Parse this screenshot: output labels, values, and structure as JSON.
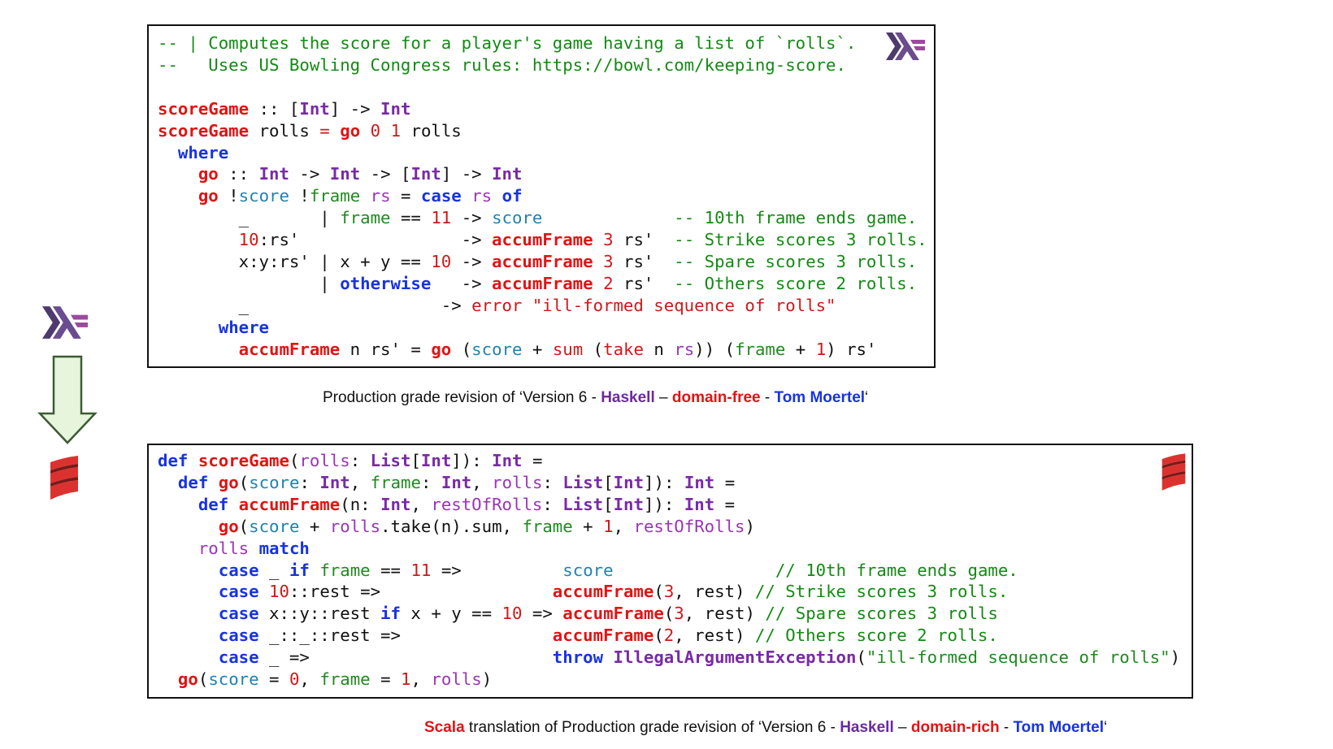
{
  "haskell_code": {
    "lines": [
      [
        {
          "t": "-- | Computes the score for a player's game having a list of `rolls`.",
          "c": "cm"
        }
      ],
      [
        {
          "t": "--   Uses US Bowling Congress rules: https://bowl.com/keeping-score.",
          "c": "cm"
        }
      ],
      [
        {
          "t": ""
        }
      ],
      [
        {
          "t": "scoreGame",
          "c": "fn"
        },
        {
          "t": " :: ["
        },
        {
          "t": "Int",
          "c": "ty"
        },
        {
          "t": "] -> "
        },
        {
          "t": "Int",
          "c": "ty"
        }
      ],
      [
        {
          "t": "scoreGame",
          "c": "fn"
        },
        {
          "t": " rolls "
        },
        {
          "t": "=",
          "c": "num"
        },
        {
          "t": " "
        },
        {
          "t": "go",
          "c": "fn"
        },
        {
          "t": " "
        },
        {
          "t": "0",
          "c": "num"
        },
        {
          "t": " "
        },
        {
          "t": "1",
          "c": "num"
        },
        {
          "t": " rolls"
        }
      ],
      [
        {
          "t": "  "
        },
        {
          "t": "where",
          "c": "kw"
        }
      ],
      [
        {
          "t": "    "
        },
        {
          "t": "go",
          "c": "fn"
        },
        {
          "t": " :: "
        },
        {
          "t": "Int",
          "c": "ty"
        },
        {
          "t": " -> "
        },
        {
          "t": "Int",
          "c": "ty"
        },
        {
          "t": " -> ["
        },
        {
          "t": "Int",
          "c": "ty"
        },
        {
          "t": "] -> "
        },
        {
          "t": "Int",
          "c": "ty"
        }
      ],
      [
        {
          "t": "    "
        },
        {
          "t": "go",
          "c": "fn"
        },
        {
          "t": " !"
        },
        {
          "t": "score",
          "c": "vb"
        },
        {
          "t": " !"
        },
        {
          "t": "frame",
          "c": "vg"
        },
        {
          "t": " "
        },
        {
          "t": "rs",
          "c": "vp"
        },
        {
          "t": " = "
        },
        {
          "t": "case",
          "c": "kw"
        },
        {
          "t": " "
        },
        {
          "t": "rs",
          "c": "vp"
        },
        {
          "t": " "
        },
        {
          "t": "of",
          "c": "kw"
        }
      ],
      [
        {
          "t": "        _       | "
        },
        {
          "t": "frame",
          "c": "vg"
        },
        {
          "t": " == "
        },
        {
          "t": "11",
          "c": "num"
        },
        {
          "t": " -> "
        },
        {
          "t": "score",
          "c": "vb"
        },
        {
          "t": "             "
        },
        {
          "t": "-- 10th frame ends game.",
          "c": "cm"
        }
      ],
      [
        {
          "t": "        "
        },
        {
          "t": "10",
          "c": "num"
        },
        {
          "t": ":rs'                -> "
        },
        {
          "t": "accumFrame",
          "c": "fn"
        },
        {
          "t": " "
        },
        {
          "t": "3",
          "c": "num"
        },
        {
          "t": " rs'  "
        },
        {
          "t": "-- Strike scores 3 rolls.",
          "c": "cm"
        }
      ],
      [
        {
          "t": "        x:y:rs' | x + y == "
        },
        {
          "t": "10",
          "c": "num"
        },
        {
          "t": " -> "
        },
        {
          "t": "accumFrame",
          "c": "fn"
        },
        {
          "t": " "
        },
        {
          "t": "3",
          "c": "num"
        },
        {
          "t": " rs'  "
        },
        {
          "t": "-- Spare scores 3 rolls.",
          "c": "cm"
        }
      ],
      [
        {
          "t": "                | "
        },
        {
          "t": "otherwise",
          "c": "kw"
        },
        {
          "t": "   -> "
        },
        {
          "t": "accumFrame",
          "c": "fn"
        },
        {
          "t": " "
        },
        {
          "t": "2",
          "c": "num"
        },
        {
          "t": " rs'  "
        },
        {
          "t": "-- Others score 2 rolls.",
          "c": "cm"
        }
      ],
      [
        {
          "t": "        _                   -> "
        },
        {
          "t": "error \"ill-formed sequence of rolls\"",
          "c": "str"
        }
      ],
      [
        {
          "t": "      "
        },
        {
          "t": "where",
          "c": "kw"
        }
      ],
      [
        {
          "t": "        "
        },
        {
          "t": "accumFrame",
          "c": "fn"
        },
        {
          "t": " n rs' = "
        },
        {
          "t": "go",
          "c": "fn"
        },
        {
          "t": " ("
        },
        {
          "t": "score",
          "c": "vb"
        },
        {
          "t": " + "
        },
        {
          "t": "sum",
          "c": "str"
        },
        {
          "t": " ("
        },
        {
          "t": "take",
          "c": "str"
        },
        {
          "t": " n "
        },
        {
          "t": "rs",
          "c": "vp"
        },
        {
          "t": ")) ("
        },
        {
          "t": "frame",
          "c": "vg"
        },
        {
          "t": " + "
        },
        {
          "t": "1",
          "c": "num"
        },
        {
          "t": ") rs'"
        }
      ]
    ]
  },
  "haskell_caption": [
    {
      "t": "Production grade revision of ‘Version 6 - "
    },
    {
      "t": "Haskell",
      "c": "c-purple"
    },
    {
      "t": " – "
    },
    {
      "t": "domain-free",
      "c": "c-red"
    },
    {
      "t": " - "
    },
    {
      "t": "Tom Moertel",
      "c": "c-blue"
    },
    {
      "t": "‘"
    }
  ],
  "scala_code": {
    "lines": [
      [
        {
          "t": "def",
          "c": "kw"
        },
        {
          "t": " "
        },
        {
          "t": "scoreGame",
          "c": "fn"
        },
        {
          "t": "("
        },
        {
          "t": "rolls",
          "c": "vp"
        },
        {
          "t": ": "
        },
        {
          "t": "List",
          "c": "ty"
        },
        {
          "t": "["
        },
        {
          "t": "Int",
          "c": "ty"
        },
        {
          "t": "]): "
        },
        {
          "t": "Int",
          "c": "ty"
        },
        {
          "t": " ="
        }
      ],
      [
        {
          "t": "  "
        },
        {
          "t": "def",
          "c": "kw"
        },
        {
          "t": " "
        },
        {
          "t": "go",
          "c": "fn"
        },
        {
          "t": "("
        },
        {
          "t": "score",
          "c": "vb"
        },
        {
          "t": ": "
        },
        {
          "t": "Int",
          "c": "ty"
        },
        {
          "t": ", "
        },
        {
          "t": "frame",
          "c": "vg"
        },
        {
          "t": ": "
        },
        {
          "t": "Int",
          "c": "ty"
        },
        {
          "t": ", "
        },
        {
          "t": "rolls",
          "c": "vp"
        },
        {
          "t": ": "
        },
        {
          "t": "List",
          "c": "ty"
        },
        {
          "t": "["
        },
        {
          "t": "Int",
          "c": "ty"
        },
        {
          "t": "]): "
        },
        {
          "t": "Int",
          "c": "ty"
        },
        {
          "t": " ="
        }
      ],
      [
        {
          "t": "    "
        },
        {
          "t": "def",
          "c": "kw"
        },
        {
          "t": " "
        },
        {
          "t": "accumFrame",
          "c": "fn"
        },
        {
          "t": "(n: "
        },
        {
          "t": "Int",
          "c": "ty"
        },
        {
          "t": ", "
        },
        {
          "t": "restOfRolls",
          "c": "vp"
        },
        {
          "t": ": "
        },
        {
          "t": "List",
          "c": "ty"
        },
        {
          "t": "["
        },
        {
          "t": "Int",
          "c": "ty"
        },
        {
          "t": "]): "
        },
        {
          "t": "Int",
          "c": "ty"
        },
        {
          "t": " ="
        }
      ],
      [
        {
          "t": "      "
        },
        {
          "t": "go",
          "c": "fn"
        },
        {
          "t": "("
        },
        {
          "t": "score",
          "c": "vb"
        },
        {
          "t": " + "
        },
        {
          "t": "rolls",
          "c": "vp"
        },
        {
          "t": ".take(n).sum, "
        },
        {
          "t": "frame",
          "c": "vg"
        },
        {
          "t": " + "
        },
        {
          "t": "1",
          "c": "num"
        },
        {
          "t": ", "
        },
        {
          "t": "restOfRolls",
          "c": "vp"
        },
        {
          "t": ")"
        }
      ],
      [
        {
          "t": "    "
        },
        {
          "t": "rolls",
          "c": "vp"
        },
        {
          "t": " "
        },
        {
          "t": "match",
          "c": "kw"
        }
      ],
      [
        {
          "t": "      "
        },
        {
          "t": "case",
          "c": "kw"
        },
        {
          "t": " _ "
        },
        {
          "t": "if",
          "c": "kw"
        },
        {
          "t": " "
        },
        {
          "t": "frame",
          "c": "vg"
        },
        {
          "t": " == "
        },
        {
          "t": "11",
          "c": "num"
        },
        {
          "t": " =>          "
        },
        {
          "t": "score",
          "c": "vb"
        },
        {
          "t": "                "
        },
        {
          "t": "// 10th frame ends game.",
          "c": "cm"
        }
      ],
      [
        {
          "t": "      "
        },
        {
          "t": "case",
          "c": "kw"
        },
        {
          "t": " "
        },
        {
          "t": "10",
          "c": "num"
        },
        {
          "t": "::rest =>                 "
        },
        {
          "t": "accumFrame",
          "c": "fn"
        },
        {
          "t": "("
        },
        {
          "t": "3",
          "c": "num"
        },
        {
          "t": ", rest) "
        },
        {
          "t": "// Strike scores 3 rolls.",
          "c": "cm"
        }
      ],
      [
        {
          "t": "      "
        },
        {
          "t": "case",
          "c": "kw"
        },
        {
          "t": " x::y::rest "
        },
        {
          "t": "if",
          "c": "kw"
        },
        {
          "t": " x + y == "
        },
        {
          "t": "10",
          "c": "num"
        },
        {
          "t": " => "
        },
        {
          "t": "accumFrame",
          "c": "fn"
        },
        {
          "t": "("
        },
        {
          "t": "3",
          "c": "num"
        },
        {
          "t": ", rest) "
        },
        {
          "t": "// Spare scores 3 rolls",
          "c": "cm"
        }
      ],
      [
        {
          "t": "      "
        },
        {
          "t": "case",
          "c": "kw"
        },
        {
          "t": " _::_::rest =>               "
        },
        {
          "t": "accumFrame",
          "c": "fn"
        },
        {
          "t": "("
        },
        {
          "t": "2",
          "c": "num"
        },
        {
          "t": ", rest) "
        },
        {
          "t": "// Others score 2 rolls.",
          "c": "cm"
        }
      ],
      [
        {
          "t": "      "
        },
        {
          "t": "case",
          "c": "kw"
        },
        {
          "t": " _ =>                        "
        },
        {
          "t": "throw",
          "c": "kw"
        },
        {
          "t": " "
        },
        {
          "t": "IllegalArgumentException",
          "c": "ty"
        },
        {
          "t": "("
        },
        {
          "t": "\"ill-formed sequence of rolls\"",
          "c": "vg"
        },
        {
          "t": ")"
        }
      ],
      [
        {
          "t": "  "
        },
        {
          "t": "go",
          "c": "fn"
        },
        {
          "t": "("
        },
        {
          "t": "score",
          "c": "vb"
        },
        {
          "t": " = "
        },
        {
          "t": "0",
          "c": "num"
        },
        {
          "t": ", "
        },
        {
          "t": "frame",
          "c": "vg"
        },
        {
          "t": " = "
        },
        {
          "t": "1",
          "c": "num"
        },
        {
          "t": ", "
        },
        {
          "t": "rolls",
          "c": "vp"
        },
        {
          "t": ")"
        }
      ]
    ]
  },
  "scala_caption": [
    {
      "t": "Scala",
      "c": "c-red"
    },
    {
      "t": " translation of Production grade revision of ‘Version 6 - "
    },
    {
      "t": "Haskell",
      "c": "c-purple"
    },
    {
      "t": " – "
    },
    {
      "t": "domain-rich",
      "c": "c-red"
    },
    {
      "t": " - "
    },
    {
      "t": "Tom Moertel",
      "c": "c-blue"
    },
    {
      "t": "‘"
    }
  ],
  "icons": {
    "haskell": "haskell-logo-icon",
    "scala": "scala-logo-icon",
    "arrow": "down-arrow-icon"
  },
  "colors": {
    "keyword": "#1833e0",
    "function": "#e01414",
    "type": "#7a2aa6",
    "comment": "#138a13",
    "arrow_fill": "#e6f5dc"
  }
}
